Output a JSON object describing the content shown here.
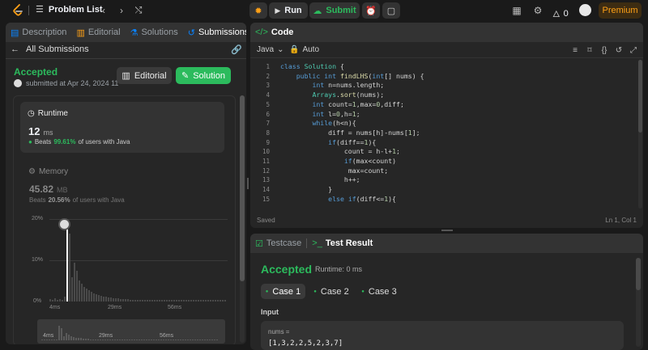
{
  "topbar": {
    "problem_list": "Problem List",
    "run": "Run",
    "submit": "Submit",
    "fire_count": "0",
    "premium": "Premium"
  },
  "left": {
    "tabs": [
      {
        "label": "Description"
      },
      {
        "label": "Editorial"
      },
      {
        "label": "Solutions"
      },
      {
        "label": "Submissions"
      }
    ],
    "all_submissions": "All Submissions",
    "status": "Accepted",
    "submitted": "submitted at Apr 24, 2024 11",
    "editorial_btn": "Editorial",
    "solution_btn": "Solution",
    "runtime": {
      "title": "Runtime",
      "value": "12",
      "unit": "ms",
      "beats_prefix": "Beats",
      "beats_pct": "99.61%",
      "beats_suffix": "of users with Java"
    },
    "memory": {
      "title": "Memory",
      "value": "45.82",
      "unit": "MB",
      "beats_prefix": "Beats",
      "beats_pct": "20.56%",
      "beats_suffix": "of users with Java"
    },
    "chart": {
      "yticks": [
        "20%",
        "10%",
        "0%"
      ],
      "xticks": [
        "4ms",
        "29ms",
        "56ms"
      ],
      "mini_xticks": [
        "4ms",
        "29ms",
        "56ms"
      ]
    }
  },
  "code": {
    "title": "Code",
    "language": "Java",
    "mode": "Auto",
    "status": "Saved",
    "cursor": "Ln 1, Col 1",
    "lines": [
      {
        "n": "1",
        "t": "class Solution {"
      },
      {
        "n": "2",
        "t": "    public int findLHS(int[] nums) {"
      },
      {
        "n": "3",
        "t": "        int n=nums.length;"
      },
      {
        "n": "4",
        "t": "        Arrays.sort(nums);"
      },
      {
        "n": "5",
        "t": "        int count=1,max=0,diff;"
      },
      {
        "n": "6",
        "t": "        int l=0,h=1;"
      },
      {
        "n": "7",
        "t": "        while(h<n){"
      },
      {
        "n": "8",
        "t": "            diff = nums[h]-nums[1];"
      },
      {
        "n": "9",
        "t": "            if(diff==1){"
      },
      {
        "n": "10",
        "t": "                count = h-l+1;"
      },
      {
        "n": "11",
        "t": "                if(max<count)"
      },
      {
        "n": "12",
        "t": "                 max=count;"
      },
      {
        "n": "13",
        "t": "                h++;"
      },
      {
        "n": "14",
        "t": "            }"
      },
      {
        "n": "15",
        "t": "            else if(diff<=1){"
      }
    ]
  },
  "result": {
    "tab_testcase": "Testcase",
    "tab_result": "Test Result",
    "status": "Accepted",
    "runtime": "Runtime: 0 ms",
    "cases": [
      "Case 1",
      "Case 2",
      "Case 3"
    ],
    "input_label": "Input",
    "param": "nums =",
    "value": "[1,3,2,2,5,2,3,7]"
  },
  "colors": {
    "accent_green": "#2cbb5d",
    "orange": "#ffa116",
    "blue": "#0a84ff"
  }
}
